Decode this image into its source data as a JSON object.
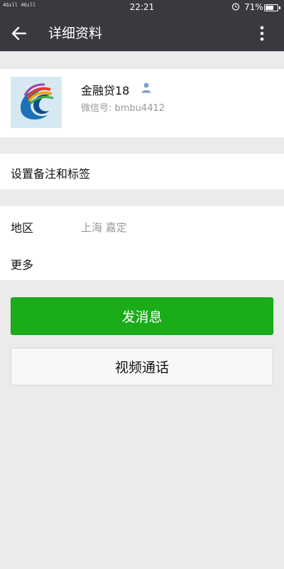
{
  "status_bar": {
    "signal_left": "4G",
    "signal_right": "4G",
    "time": "22:21",
    "battery_percent": "71%",
    "battery_level": 0.71,
    "alarm_icon": "alarm-icon",
    "battery_icon": "battery-icon"
  },
  "nav": {
    "title": "详细资料",
    "back_icon": "back-arrow-icon",
    "more_icon": "more-vertical-icon"
  },
  "profile": {
    "name": "金融贷18",
    "wechat_id": "微信号: bmbu4412",
    "badge_icon": "user-icon"
  },
  "remark": {
    "label": "设置备注和标签"
  },
  "info": {
    "region_label": "地区",
    "region_value": "上海  嘉定",
    "more_label": "更多"
  },
  "actions": {
    "send_message": "发消息",
    "video_call": "视频通话"
  },
  "colors": {
    "header_bg": "#393a3f",
    "primary_green": "#1aad19",
    "page_bg": "#ebebeb"
  }
}
